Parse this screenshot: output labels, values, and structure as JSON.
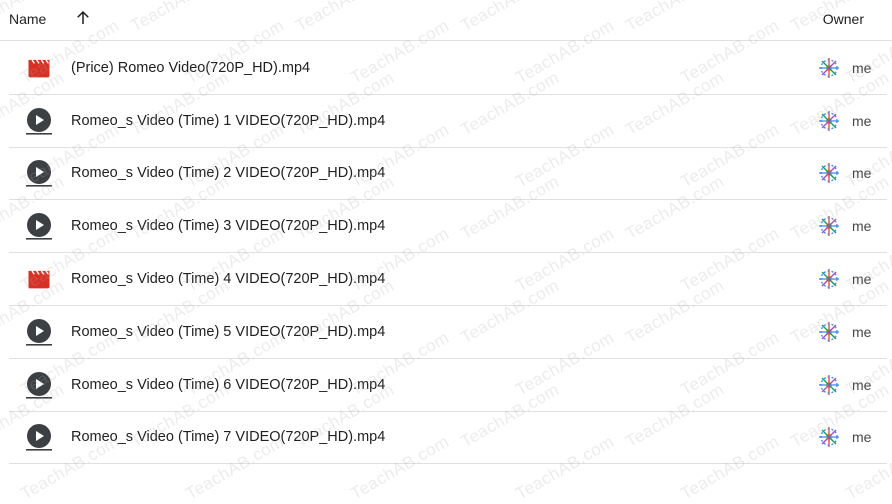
{
  "header": {
    "name_label": "Name",
    "owner_label": "Owner",
    "sort_icon": "arrow-up-icon"
  },
  "files": [
    {
      "name": "(Price) Romeo Video(720P_HD).mp4",
      "type": "video-file",
      "owner": "me"
    },
    {
      "name": "Romeo_s Video (Time) 1 VIDEO(720P_HD).mp4",
      "type": "play",
      "owner": "me"
    },
    {
      "name": "Romeo_s Video (Time) 2 VIDEO(720P_HD).mp4",
      "type": "play",
      "owner": "me"
    },
    {
      "name": "Romeo_s Video (Time) 3 VIDEO(720P_HD).mp4",
      "type": "play",
      "owner": "me"
    },
    {
      "name": "Romeo_s Video (Time) 4 VIDEO(720P_HD).mp4",
      "type": "video-file",
      "owner": "me"
    },
    {
      "name": "Romeo_s Video (Time) 5 VIDEO(720P_HD).mp4",
      "type": "play",
      "owner": "me"
    },
    {
      "name": "Romeo_s Video (Time) 6 VIDEO(720P_HD).mp4",
      "type": "play",
      "owner": "me"
    },
    {
      "name": "Romeo_s Video (Time) 7 VIDEO(720P_HD).mp4",
      "type": "play",
      "owner": "me"
    }
  ],
  "watermark": "TeachAB.com",
  "colors": {
    "video_icon": "#d93025",
    "play_icon": "#3c4043",
    "divider": "#e0e0e0"
  }
}
